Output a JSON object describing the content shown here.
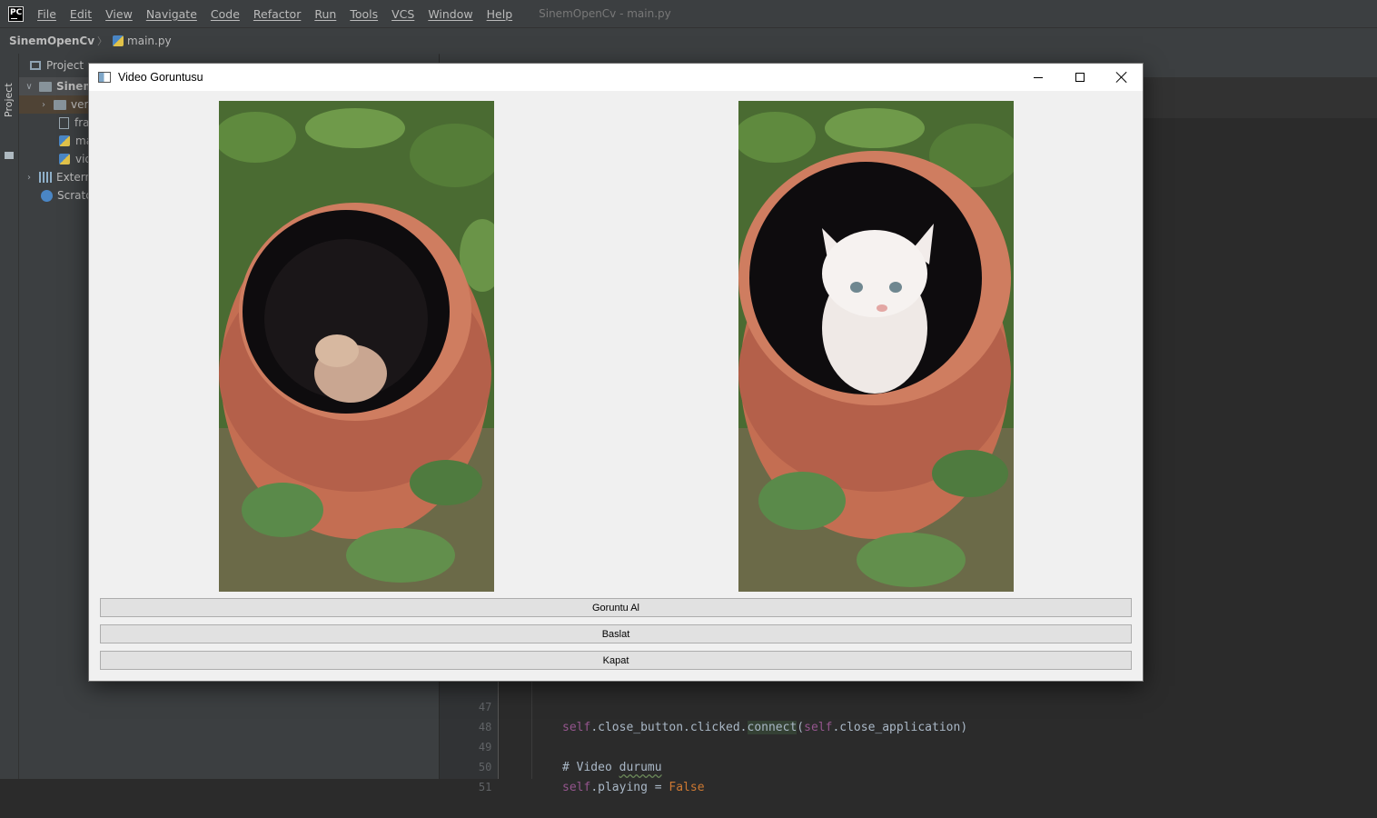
{
  "ide": {
    "menu": [
      "File",
      "Edit",
      "View",
      "Navigate",
      "Code",
      "Refactor",
      "Run",
      "Tools",
      "VCS",
      "Window",
      "Help"
    ],
    "window_title": "SinemOpenCv - main.py",
    "breadcrumb": {
      "project": "SinemOpenCv",
      "file": "main.py"
    },
    "left_strip_label": "Project",
    "project_panel": {
      "title": "Project",
      "tree": [
        {
          "label": "Sinem",
          "type": "folder",
          "expanded": true
        },
        {
          "label": "ver",
          "type": "folder",
          "expanded": false
        },
        {
          "label": "fran",
          "type": "file"
        },
        {
          "label": "ma",
          "type": "pyfile"
        },
        {
          "label": "vid",
          "type": "pyfile"
        },
        {
          "label": "Extern",
          "type": "library"
        },
        {
          "label": "Scratcl",
          "type": "scratch"
        }
      ]
    },
    "code": {
      "lines": [
        {
          "number": "47",
          "self": "self",
          "before": ".close_button.clicked.",
          "call": "connect",
          "open": "(",
          "self2": "self",
          "after": ".close_application)"
        },
        {
          "number": "48"
        },
        {
          "number": "49",
          "comment_a": "# Video ",
          "comment_b": "durumu"
        },
        {
          "number": "50",
          "self": "self",
          "assign": ".playing = ",
          "value": "False"
        },
        {
          "number": "51"
        }
      ]
    }
  },
  "qt_window": {
    "title": "Video Goruntusu",
    "buttons": {
      "capture": "Goruntu Al",
      "start": "Baslat",
      "close": "Kapat"
    }
  }
}
